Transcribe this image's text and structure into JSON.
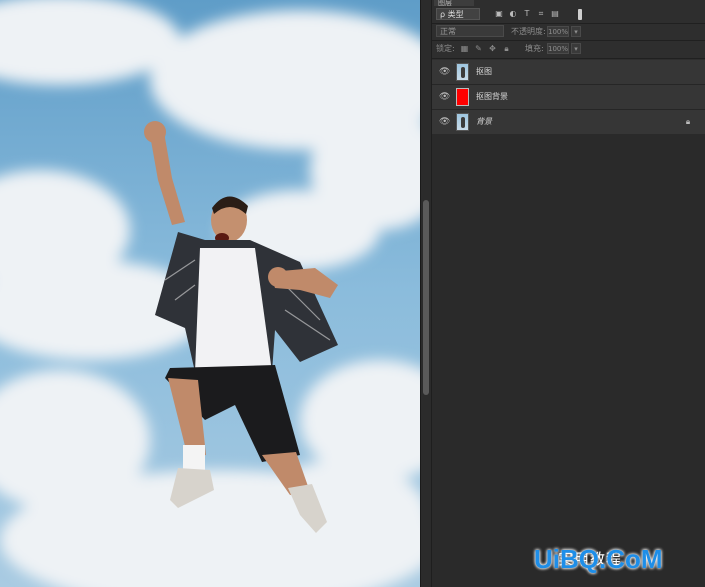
{
  "panel": {
    "tab_label": "图层",
    "filter": {
      "kind_label": "ρ 类型",
      "icons": [
        "image-filter-icon",
        "adjustment-filter-icon",
        "text-filter-icon",
        "shape-filter-icon",
        "smart-object-filter-icon"
      ]
    },
    "blend_mode": "正常",
    "opacity_label": "不透明度:",
    "opacity_value": "100%",
    "lock_label": "锁定:",
    "fill_label": "填充:",
    "fill_value": "100%"
  },
  "layers": [
    {
      "name": "抠图",
      "thumb": "photo",
      "visible": true,
      "locked": false,
      "italic": false
    },
    {
      "name": "抠图背景",
      "thumb": "red",
      "color": "#ff0000",
      "visible": true,
      "locked": false,
      "italic": false
    },
    {
      "name": "背景",
      "thumb": "photo",
      "visible": true,
      "locked": true,
      "italic": true
    }
  ],
  "watermark": {
    "text": "实用教程",
    "logo": "UiBQ.CoM"
  }
}
